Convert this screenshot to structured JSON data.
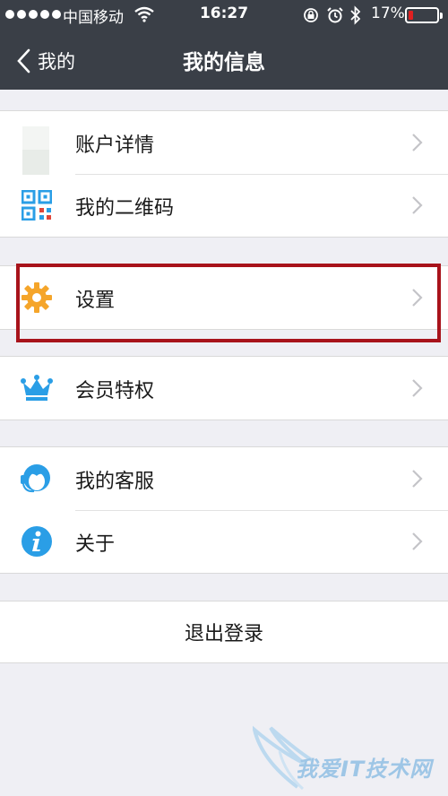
{
  "status_bar": {
    "carrier": "中国移动",
    "time": "16:27",
    "battery_percent": "17%",
    "battery_level": 0.17,
    "battery_color": "#e02020"
  },
  "navbar": {
    "back_label": "我的",
    "title": "我的信息",
    "background": "#3a3f47"
  },
  "groups": [
    {
      "items": [
        {
          "label": "账户详情",
          "icon": "avatar-placeholder-icon"
        },
        {
          "label": "我的二维码",
          "icon": "qr-code-icon"
        }
      ]
    },
    {
      "items": [
        {
          "label": "设置",
          "icon": "gear-icon",
          "icon_color": "#f5a52a"
        }
      ]
    },
    {
      "items": [
        {
          "label": "会员特权",
          "icon": "crown-icon",
          "icon_color": "#2a9ee6"
        }
      ]
    },
    {
      "items": [
        {
          "label": "我的客服",
          "icon": "customer-service-icon",
          "icon_color": "#2a9ee6"
        },
        {
          "label": "关于",
          "icon": "info-icon",
          "icon_color": "#2a9ee6"
        }
      ]
    }
  ],
  "logout_label": "退出登录",
  "highlight_color": "#a8131b",
  "watermark": {
    "text": "我爱IT技术网"
  }
}
